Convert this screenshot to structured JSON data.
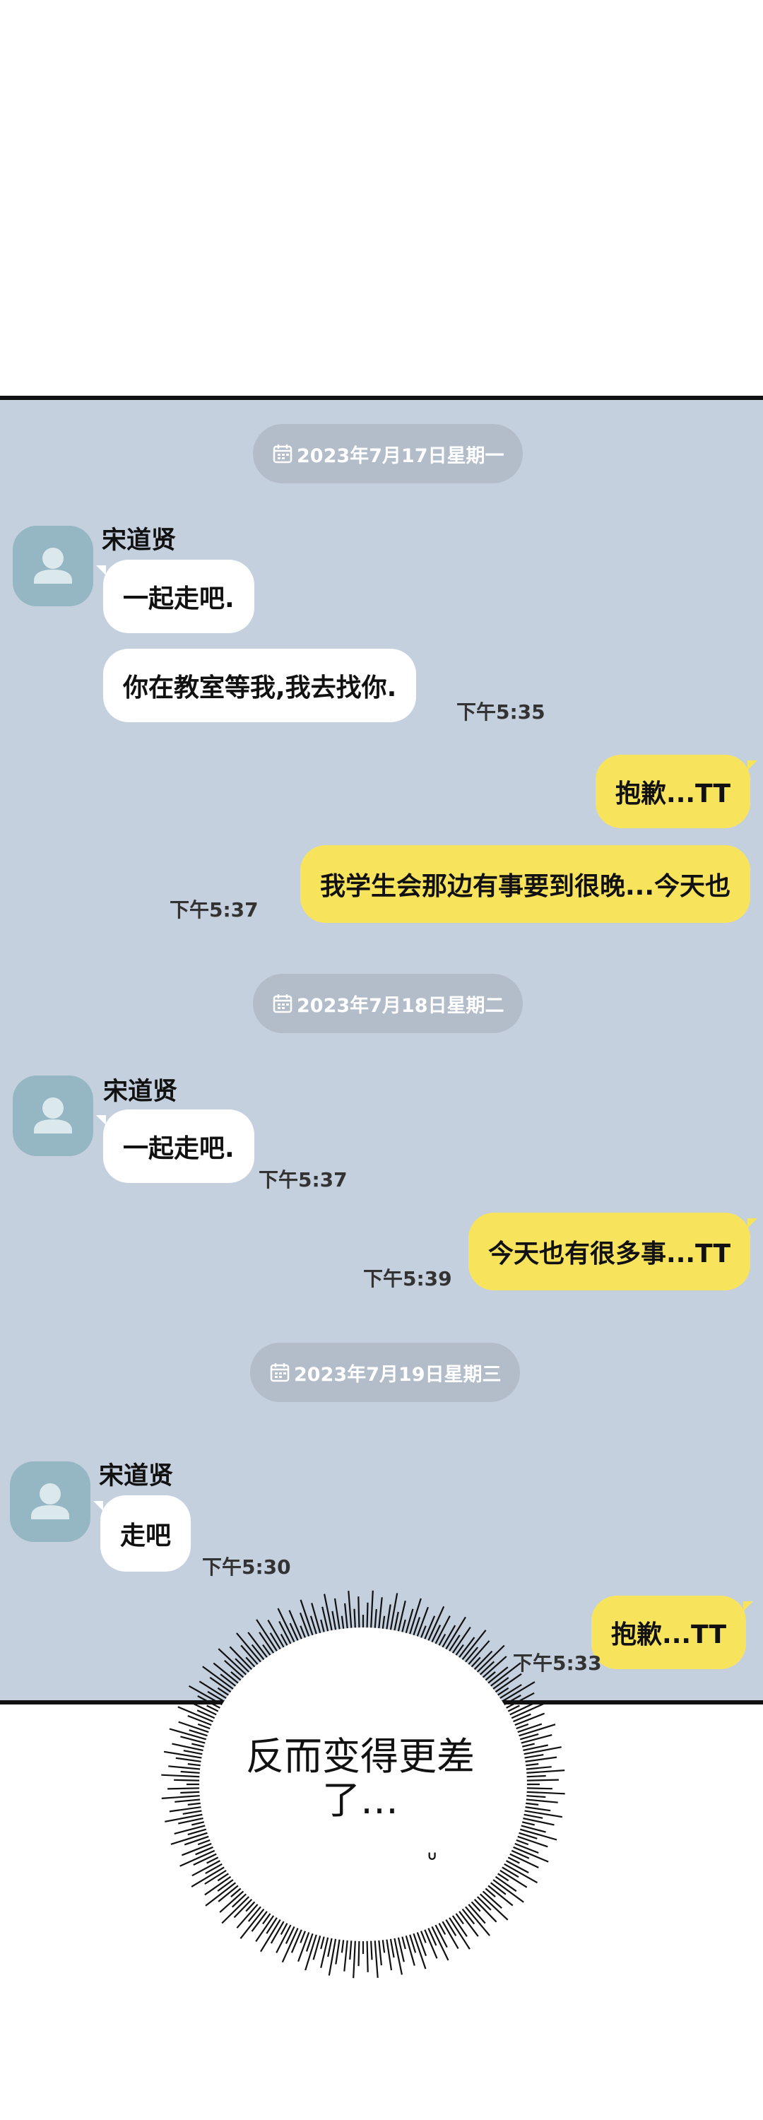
{
  "chat": {
    "days": [
      {
        "date": "2023年7月17日星期一",
        "sender": "宋道贤",
        "in_messages": [
          "一起走吧.",
          "你在教室等我,我去找你."
        ],
        "in_time": "下午5:35",
        "out_messages": [
          "抱歉...TT",
          "我学生会那边有事要到很晚...今天也"
        ],
        "out_time": "下午5:37"
      },
      {
        "date": "2023年7月18日星期二",
        "sender": "宋道贤",
        "in_messages": [
          "一起走吧."
        ],
        "in_time": "下午5:37",
        "out_messages": [
          "今天也有很多事...TT"
        ],
        "out_time": "下午5:39"
      },
      {
        "date": "2023年7月19日星期三",
        "sender": "宋道贤",
        "in_messages": [
          "走吧"
        ],
        "in_time": "下午5:30",
        "out_messages": [
          "抱歉...TT"
        ],
        "out_time": "下午5:33"
      }
    ]
  },
  "narration": {
    "line1": "反而变得更差",
    "line2": "了…",
    "sweat_mark": "ᐡ"
  },
  "icons": {
    "calendar": "calendar-icon",
    "avatar": "default-user-avatar-icon"
  },
  "colors": {
    "chat_background": "#c5d0df",
    "date_chip": "#b3bcc9",
    "incoming_bubble": "#ffffff",
    "outgoing_bubble": "#f7e45c",
    "avatar": "#95b6c3"
  }
}
